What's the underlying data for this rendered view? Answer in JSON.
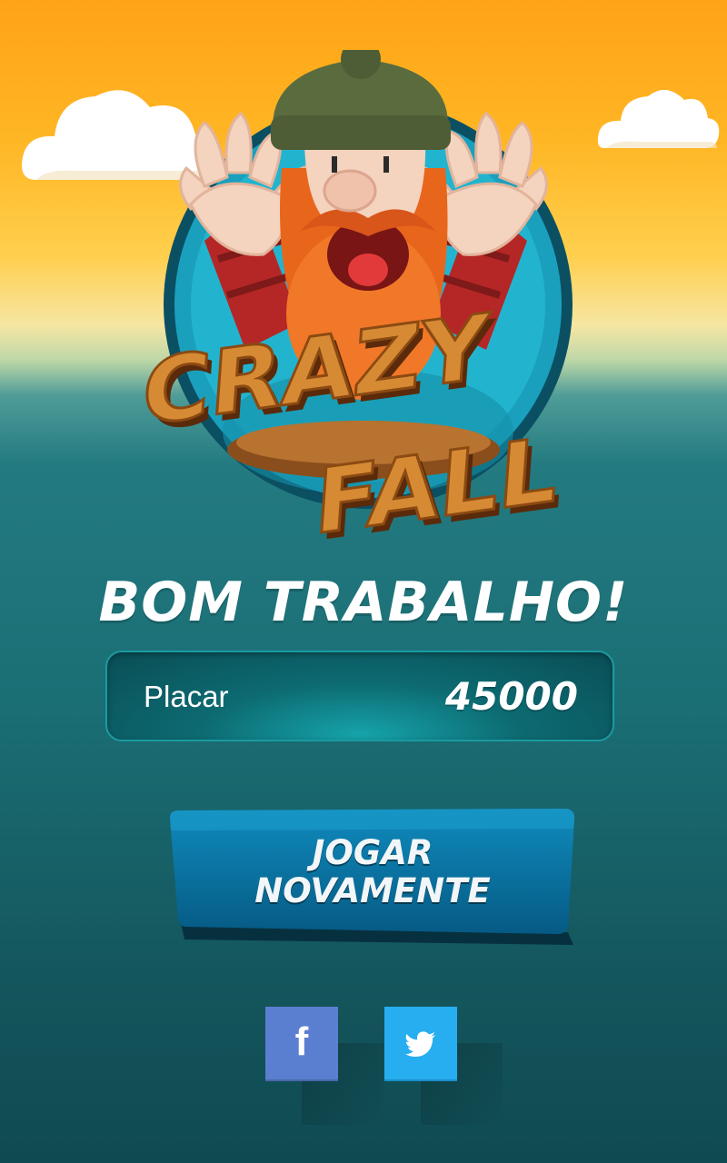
{
  "logo": {
    "line1": "CRAZY",
    "line2": "FALL"
  },
  "result": {
    "title": "BOM TRABALHO!"
  },
  "score": {
    "label": "Placar",
    "value": "45000"
  },
  "play_button": {
    "line1": "JOGAR",
    "line2": "NOVAMENTE"
  },
  "social": {
    "facebook_icon": "facebook-icon",
    "twitter_icon": "twitter-icon"
  },
  "colors": {
    "sky_top": "#ffa316",
    "sea_bottom": "#0f4a52",
    "button": "#0a6d99",
    "facebook": "#5b7fd0",
    "twitter": "#26aef0",
    "beard": "#e8661b",
    "hat": "#5a6b3e"
  }
}
